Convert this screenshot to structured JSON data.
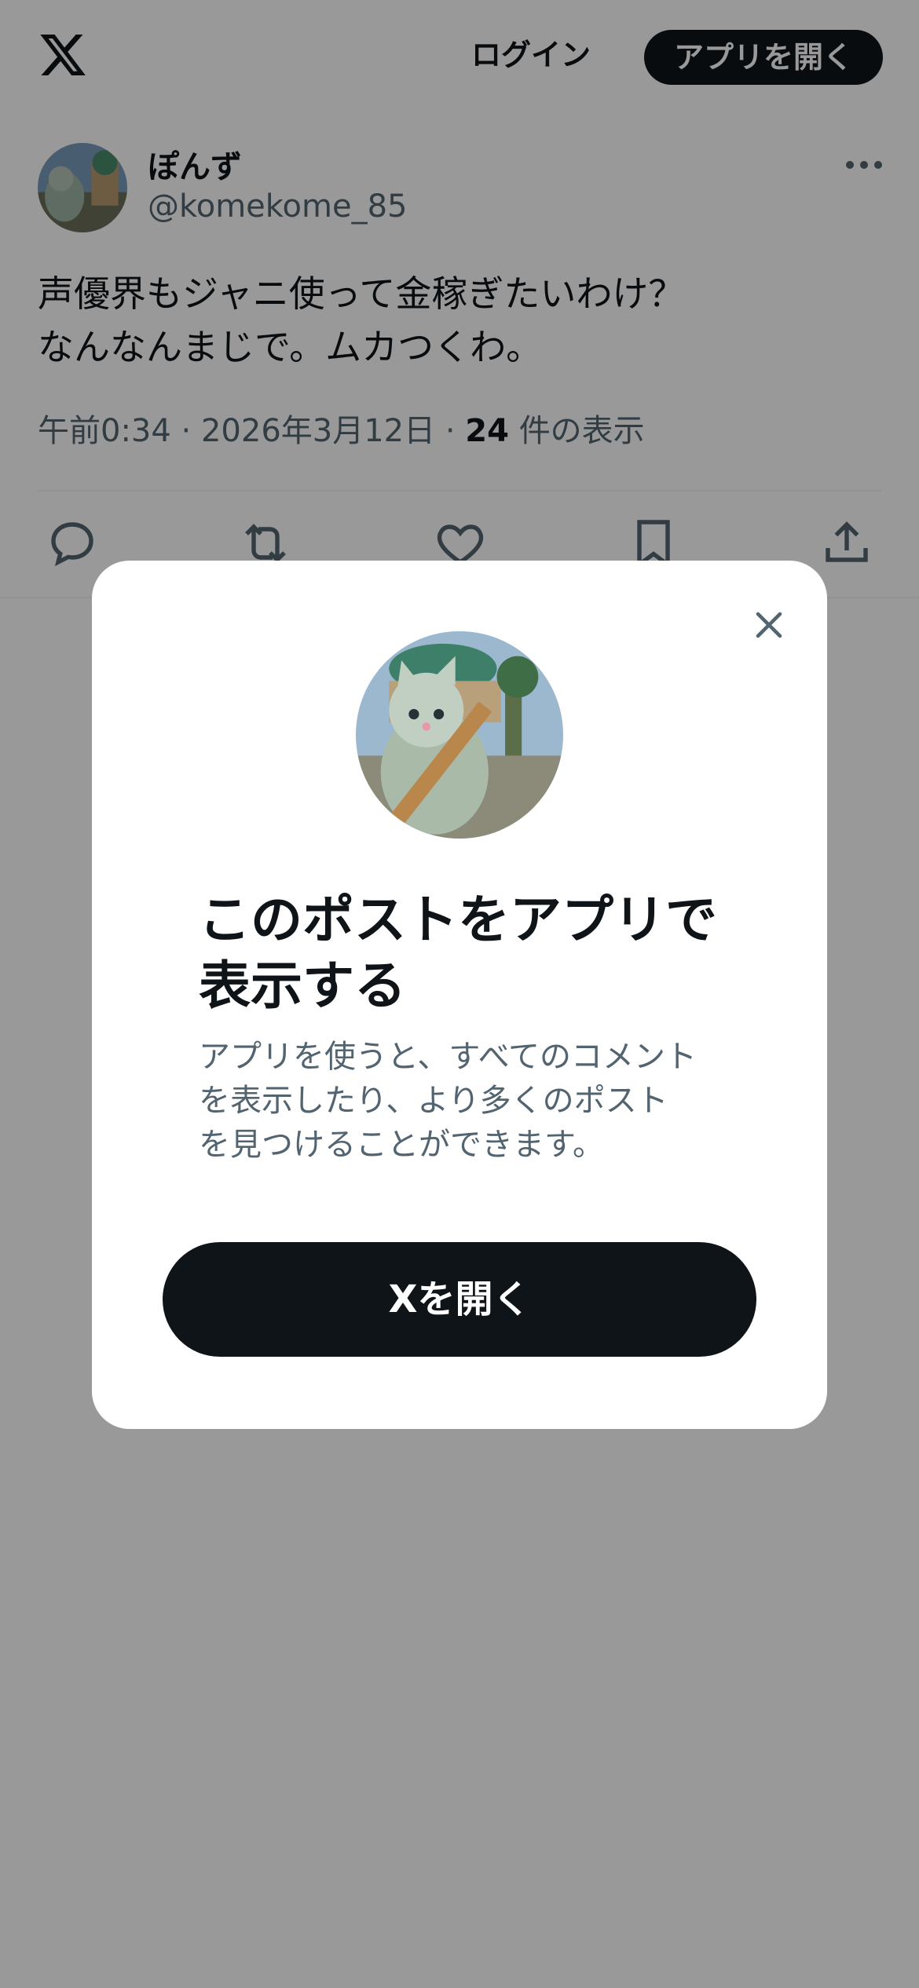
{
  "header": {
    "logo_icon": "x-logo-icon",
    "login_label": "ログイン",
    "open_app_label": "アプリを開く"
  },
  "tweet": {
    "display_name": "ぽんず",
    "handle": "@komekome_85",
    "text_lines": [
      "声優界もジャニ使って金稼ぎたいわけ？",
      "なんなんまじで。ムカつくわ。"
    ],
    "time": "午前0:34",
    "date": "2026年3月12日",
    "views_count": "24",
    "views_label": "件の表示",
    "more_icon": "more-icon",
    "action_icons": [
      "reply-icon",
      "repost-icon",
      "like-icon",
      "bookmark-icon",
      "share-icon"
    ]
  },
  "modal": {
    "close_icon": "close-icon",
    "title_lines": [
      "このポストをアプリで",
      "表示する"
    ],
    "description_lines": [
      "アプリを使うと、すべてのコメント",
      "を表示したり、より多くのポスト",
      "を見つけることができます。"
    ],
    "button_label": "Xを開く"
  },
  "colors": {
    "primary_text": "#0f1419",
    "secondary_text": "#536471",
    "button_bg": "#0f1419",
    "overlay": "rgba(0,0,0,0.4)"
  }
}
